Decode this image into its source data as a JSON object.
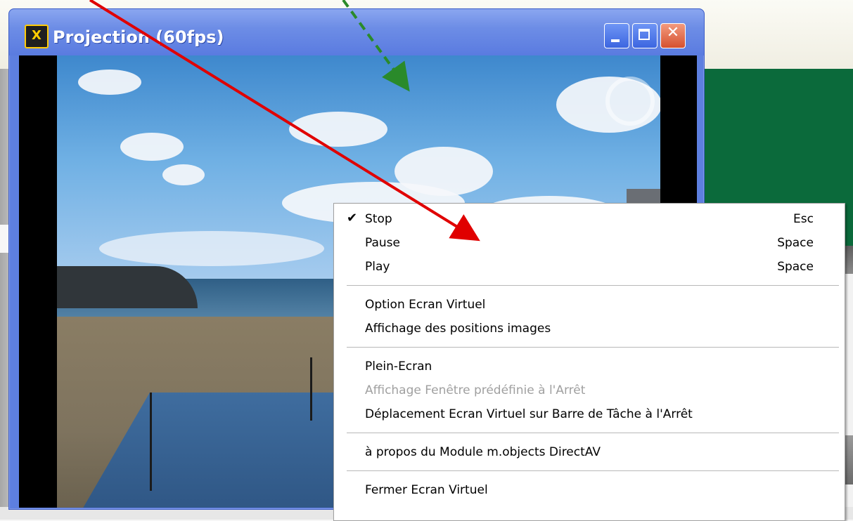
{
  "window": {
    "title": "Projection (60fps)",
    "icon": "projector-app-icon",
    "buttons": [
      "minimize-icon",
      "maximize-icon",
      "close-icon"
    ]
  },
  "context_menu": {
    "groups": [
      [
        {
          "label": "Stop",
          "shortcut": "Esc",
          "checked": true,
          "disabled": false
        },
        {
          "label": "Pause",
          "shortcut": "Space",
          "checked": false,
          "disabled": false
        },
        {
          "label": "Play",
          "shortcut": "Space",
          "checked": false,
          "disabled": false
        }
      ],
      [
        {
          "label": "Option Ecran Virtuel",
          "shortcut": "",
          "checked": false,
          "disabled": false
        },
        {
          "label": "Affichage des positions images",
          "shortcut": "",
          "checked": false,
          "disabled": false
        }
      ],
      [
        {
          "label": "Plein-Ecran",
          "shortcut": "",
          "checked": false,
          "disabled": false
        },
        {
          "label": "Affichage Fenêtre prédéfinie à l'Arrêt",
          "shortcut": "",
          "checked": false,
          "disabled": true
        },
        {
          "label": "Déplacement Ecran Virtuel sur Barre de Tâche à l'Arrêt",
          "shortcut": "",
          "checked": false,
          "disabled": false
        }
      ],
      [
        {
          "label": "à propos du Module m.objects DirectAV",
          "shortcut": "",
          "checked": false,
          "disabled": false
        }
      ],
      [
        {
          "label": "Fermer Ecran Virtuel",
          "shortcut": "",
          "checked": false,
          "disabled": false
        }
      ]
    ],
    "check_glyph": "✔"
  },
  "annotations": {
    "red_arrow_color": "#e00000",
    "green_arrow_color": "#2a8a2a"
  }
}
